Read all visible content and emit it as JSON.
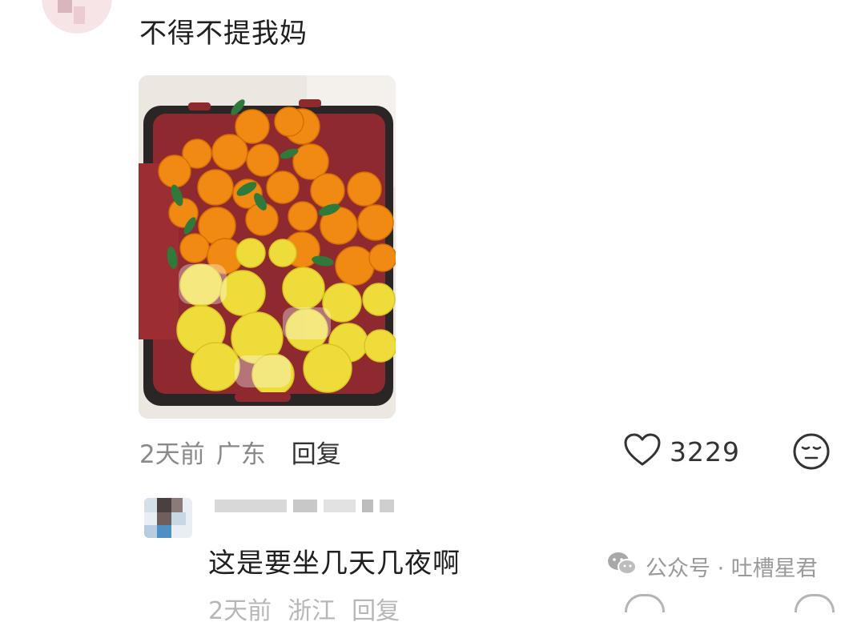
{
  "comment": {
    "text": "不得不提我妈",
    "time": "2天前",
    "location": "广东",
    "reply_label": "回复",
    "likes": "3229",
    "photo_icon": "image-of-oranges-and-lemons-in-suitcase"
  },
  "reply": {
    "text": "这是要坐几天几夜啊",
    "time": "2天前",
    "location": "浙江",
    "reply_label": "回复"
  },
  "watermark": {
    "text": "公众号 · 吐槽星君",
    "icon": "wechat-icon"
  },
  "icons": {
    "like": "heart-icon",
    "emoji": "neutral-face-icon"
  }
}
